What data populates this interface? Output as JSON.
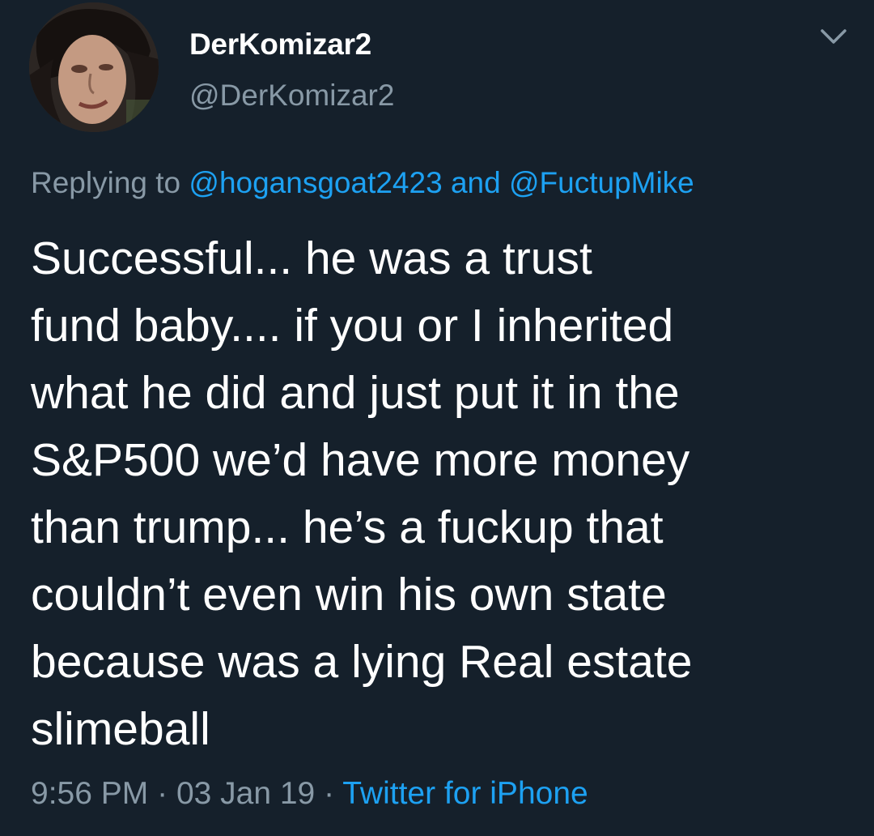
{
  "author": {
    "display_name": "DerKomizar2",
    "handle": "@DerKomizar2"
  },
  "reply": {
    "prefix": "Replying to",
    "mention1": "@hogansgoat2423",
    "conjunction": "and",
    "mention2": "@FuctupMike"
  },
  "body_lines": [
    "Successful... he was a trust",
    "fund baby.... if you or I inherited",
    "what he did and just put it in the",
    "S&P500 we’d have more money",
    "than trump... he’s a fuckup that",
    "couldn’t even win his own state",
    "because was a lying Real estate",
    "slimeball"
  ],
  "meta": {
    "time": "9:56 PM",
    "separator": "·",
    "date": "03 Jan 19",
    "source": "Twitter for iPhone"
  },
  "icons": {
    "menu": "chevron-down-icon",
    "avatar": "profile-photo"
  },
  "colors": {
    "background": "#15202b",
    "text": "#ffffff",
    "secondary_text": "#8899a6",
    "link": "#1da1f2"
  }
}
